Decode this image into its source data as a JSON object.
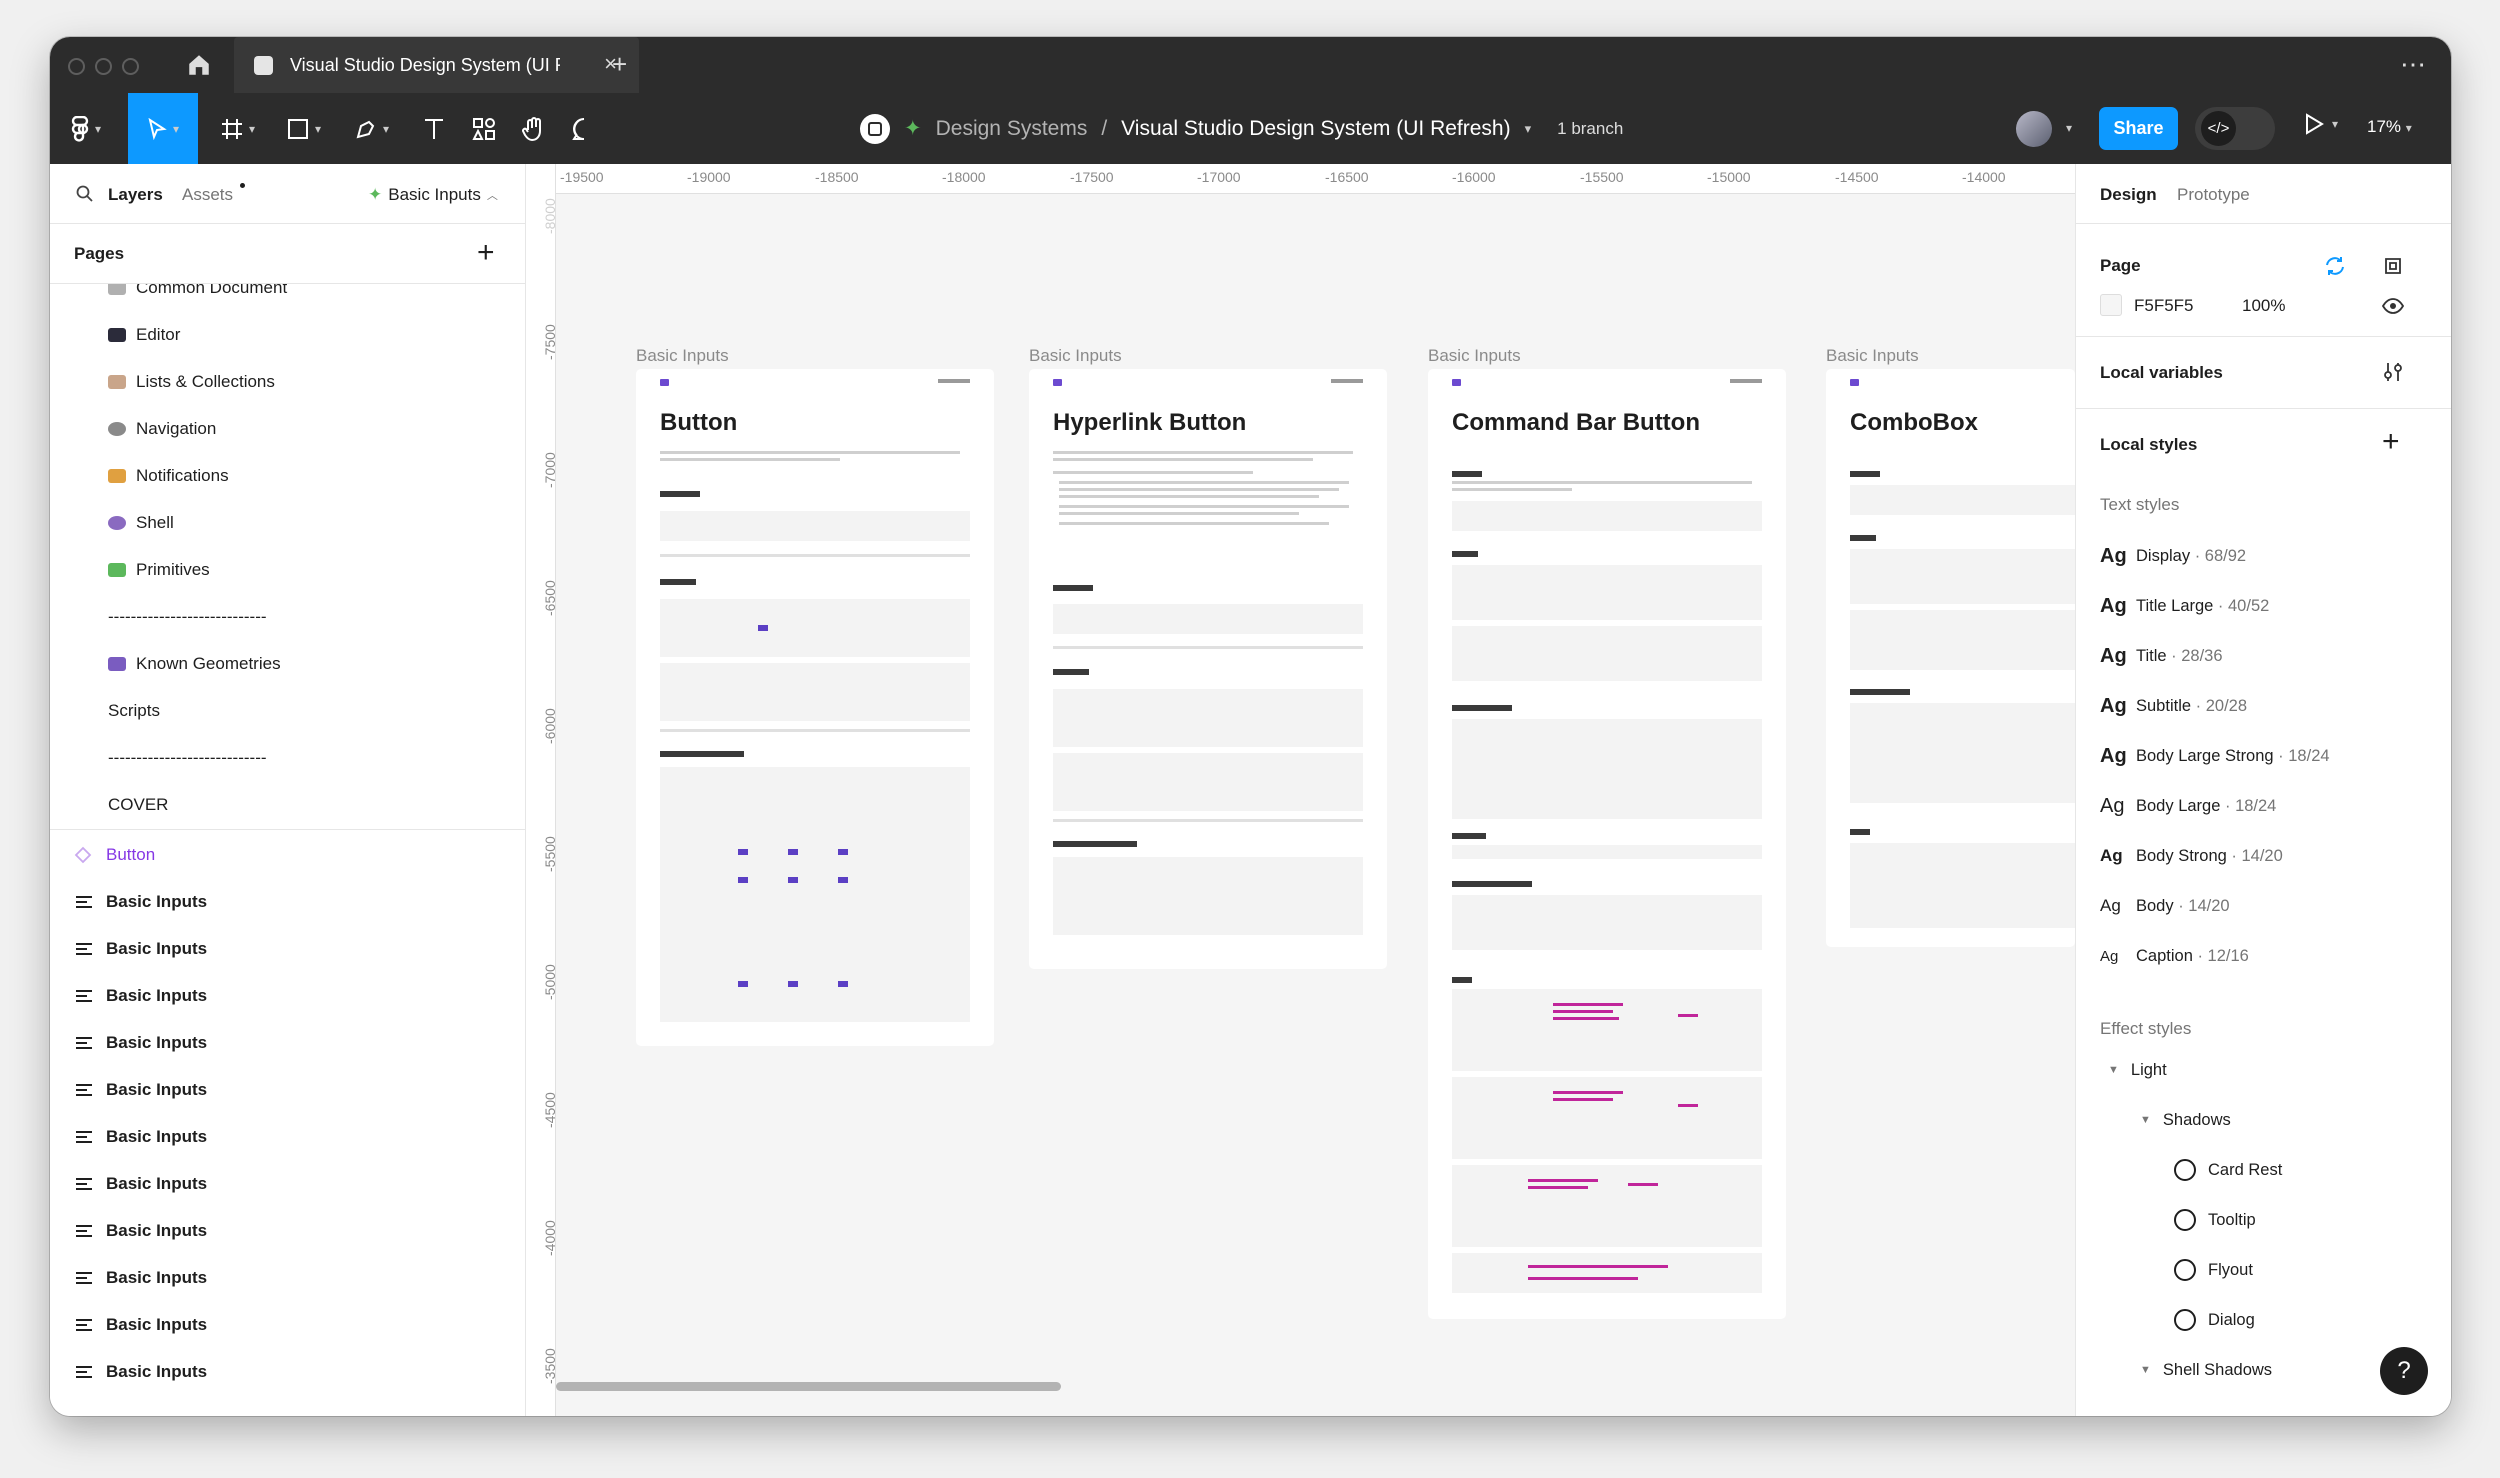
{
  "browser_tab": {
    "title": "Visual Studio Design System (UI Re",
    "close": "×",
    "new_tab": "+",
    "more": "⋯"
  },
  "toolbar": {
    "breadcrumb_project": "Design Systems",
    "breadcrumb_sep": "/",
    "file_name": "Visual Studio Design System (UI Refresh)",
    "branch": "1 branch",
    "share": "Share",
    "dev_mode": "</>",
    "zoom": "17%"
  },
  "left_panel": {
    "tab_layers": "Layers",
    "tab_assets": "Assets",
    "page_picker": "Basic Inputs",
    "pages_title": "Pages",
    "add_page": "+",
    "pages": [
      {
        "label": "Common Document",
        "color": "#b0b0b0"
      },
      {
        "label": "Editor",
        "color": "#2b2b3a"
      },
      {
        "label": "Lists & Collections",
        "color": "#c9a58a"
      },
      {
        "label": "Navigation",
        "color": "#8a8a8a"
      },
      {
        "label": "Notifications",
        "color": "#e0a040"
      },
      {
        "label": "Shell",
        "color": "#8a6ac0"
      },
      {
        "label": "Primitives",
        "color": "#5cb85c"
      },
      {
        "label": "----------------------------",
        "color": ""
      },
      {
        "label": "Known Geometries",
        "color": "#7a5cc0"
      },
      {
        "label": "Scripts",
        "color": ""
      },
      {
        "label": "----------------------------",
        "color": ""
      },
      {
        "label": "COVER",
        "color": ""
      }
    ],
    "layers": [
      {
        "label": "Button",
        "component": true
      },
      {
        "label": "Basic Inputs",
        "component": false
      },
      {
        "label": "Basic Inputs",
        "component": false
      },
      {
        "label": "Basic Inputs",
        "component": false
      },
      {
        "label": "Basic Inputs",
        "component": false
      },
      {
        "label": "Basic Inputs",
        "component": false
      },
      {
        "label": "Basic Inputs",
        "component": false
      },
      {
        "label": "Basic Inputs",
        "component": false
      },
      {
        "label": "Basic Inputs",
        "component": false
      },
      {
        "label": "Basic Inputs",
        "component": false
      },
      {
        "label": "Basic Inputs",
        "component": false
      },
      {
        "label": "Basic Inputs",
        "component": false
      }
    ]
  },
  "canvas": {
    "ruler_x": [
      "-19500",
      "-19000",
      "-18500",
      "-18000",
      "-17500",
      "-17000",
      "-16500",
      "-16000",
      "-15500",
      "-15000",
      "-14500",
      "-14000"
    ],
    "ruler_y": [
      "-8000",
      "-7500",
      "-7000",
      "-6500",
      "-6000",
      "-5500",
      "-5000",
      "-4500",
      "-4000",
      "-3500"
    ],
    "frames": [
      {
        "label": "Basic Inputs",
        "title": "Button"
      },
      {
        "label": "Basic Inputs",
        "title": "Hyperlink Button"
      },
      {
        "label": "Basic Inputs",
        "title": "Command Bar Button"
      },
      {
        "label": "Basic Inputs",
        "title": "ComboBox"
      }
    ]
  },
  "right_panel": {
    "tab_design": "Design",
    "tab_prototype": "Prototype",
    "page_title": "Page",
    "page_color": "F5F5F5",
    "page_opacity": "100%",
    "local_variables": "Local variables",
    "local_styles": "Local styles",
    "text_styles_title": "Text styles",
    "text_styles": [
      {
        "ag": "Ag",
        "name": "Display",
        "size": " · 68/92"
      },
      {
        "ag": "Ag",
        "name": "Title Large",
        "size": " · 40/52"
      },
      {
        "ag": "Ag",
        "name": "Title",
        "size": " · 28/36"
      },
      {
        "ag": "Ag",
        "name": "Subtitle",
        "size": " · 20/28"
      },
      {
        "ag": "Ag",
        "name": "Body Large Strong",
        "size": " · 18/24"
      },
      {
        "ag": "Ag",
        "name": "Body Large",
        "size": " · 18/24"
      },
      {
        "ag": "Ag",
        "name": "Body Strong",
        "size": " · 14/20"
      },
      {
        "ag": "Ag",
        "name": "Body",
        "size": " · 14/20"
      },
      {
        "ag": "Ag",
        "name": "Caption",
        "size": " · 12/16"
      }
    ],
    "effect_styles_title": "Effect styles",
    "effect_group": "Light",
    "effect_subgroup": "Shadows",
    "effects": [
      "Card Rest",
      "Tooltip",
      "Flyout",
      "Dialog"
    ],
    "effect_subgroup2": "Shell Shadows"
  },
  "help": "?"
}
